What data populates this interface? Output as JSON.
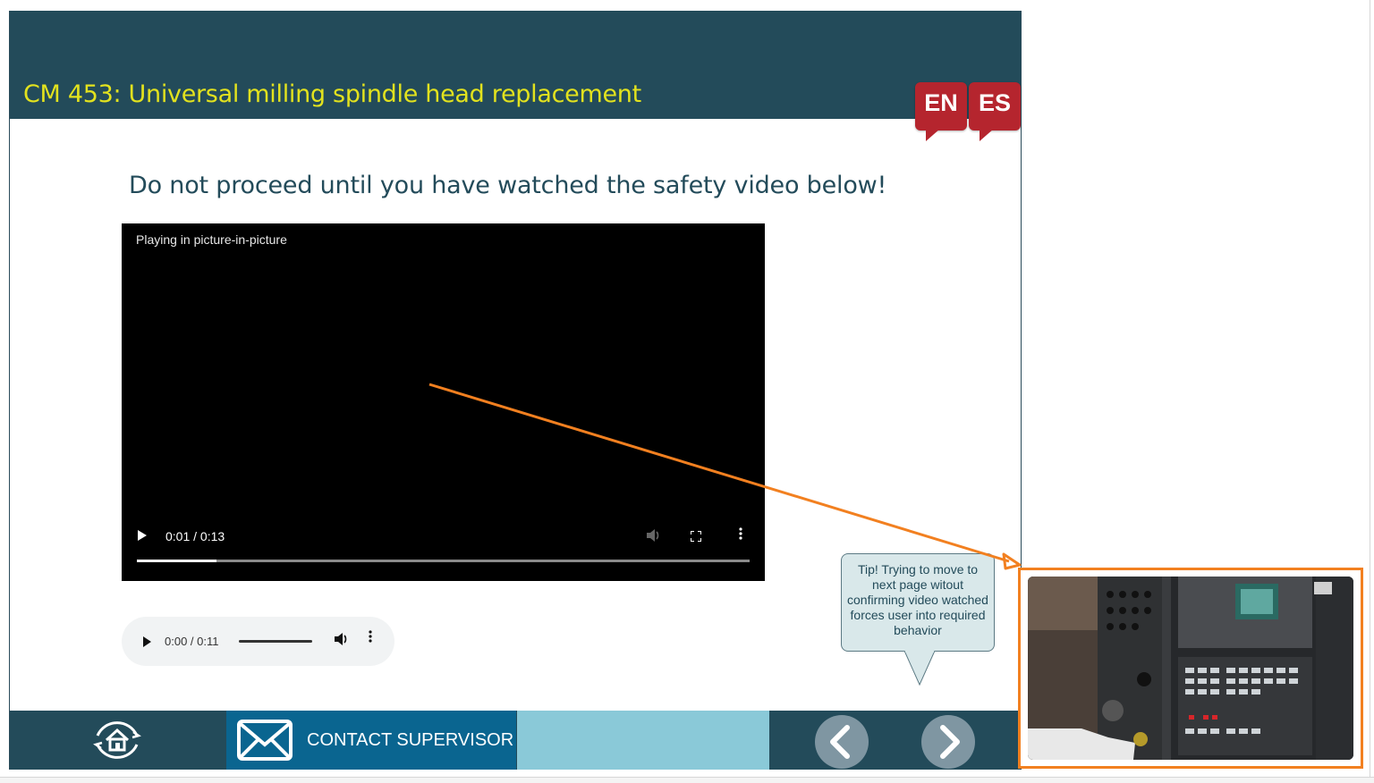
{
  "header": {
    "course_title": "CM 453: Universal milling spindle head replacement",
    "languages": [
      "EN",
      "ES"
    ]
  },
  "main": {
    "instruction": "Do not proceed until you have watched the safety video below!"
  },
  "video": {
    "status_text": "Playing in picture-in-picture",
    "time": "0:01 / 0:13",
    "progress_fraction": 0.13
  },
  "audio": {
    "time": "0:00 / 0:11"
  },
  "tip": {
    "text": "Tip! Trying to move to next page witout confirming video watched forces user into required behavior"
  },
  "footer": {
    "contact_label": "CONTACT SUPERVISOR"
  },
  "colors": {
    "header_bg": "#234b5a",
    "title_text": "#e2e21e",
    "lang_badge": "#b5252e",
    "contact_bg": "#0a6590",
    "light_block": "#8ac9d8",
    "annotation": "#f28020"
  },
  "icons": {
    "home": "home-icon",
    "mail": "mail-icon",
    "prev": "chevron-left-icon",
    "next": "chevron-right-icon"
  }
}
